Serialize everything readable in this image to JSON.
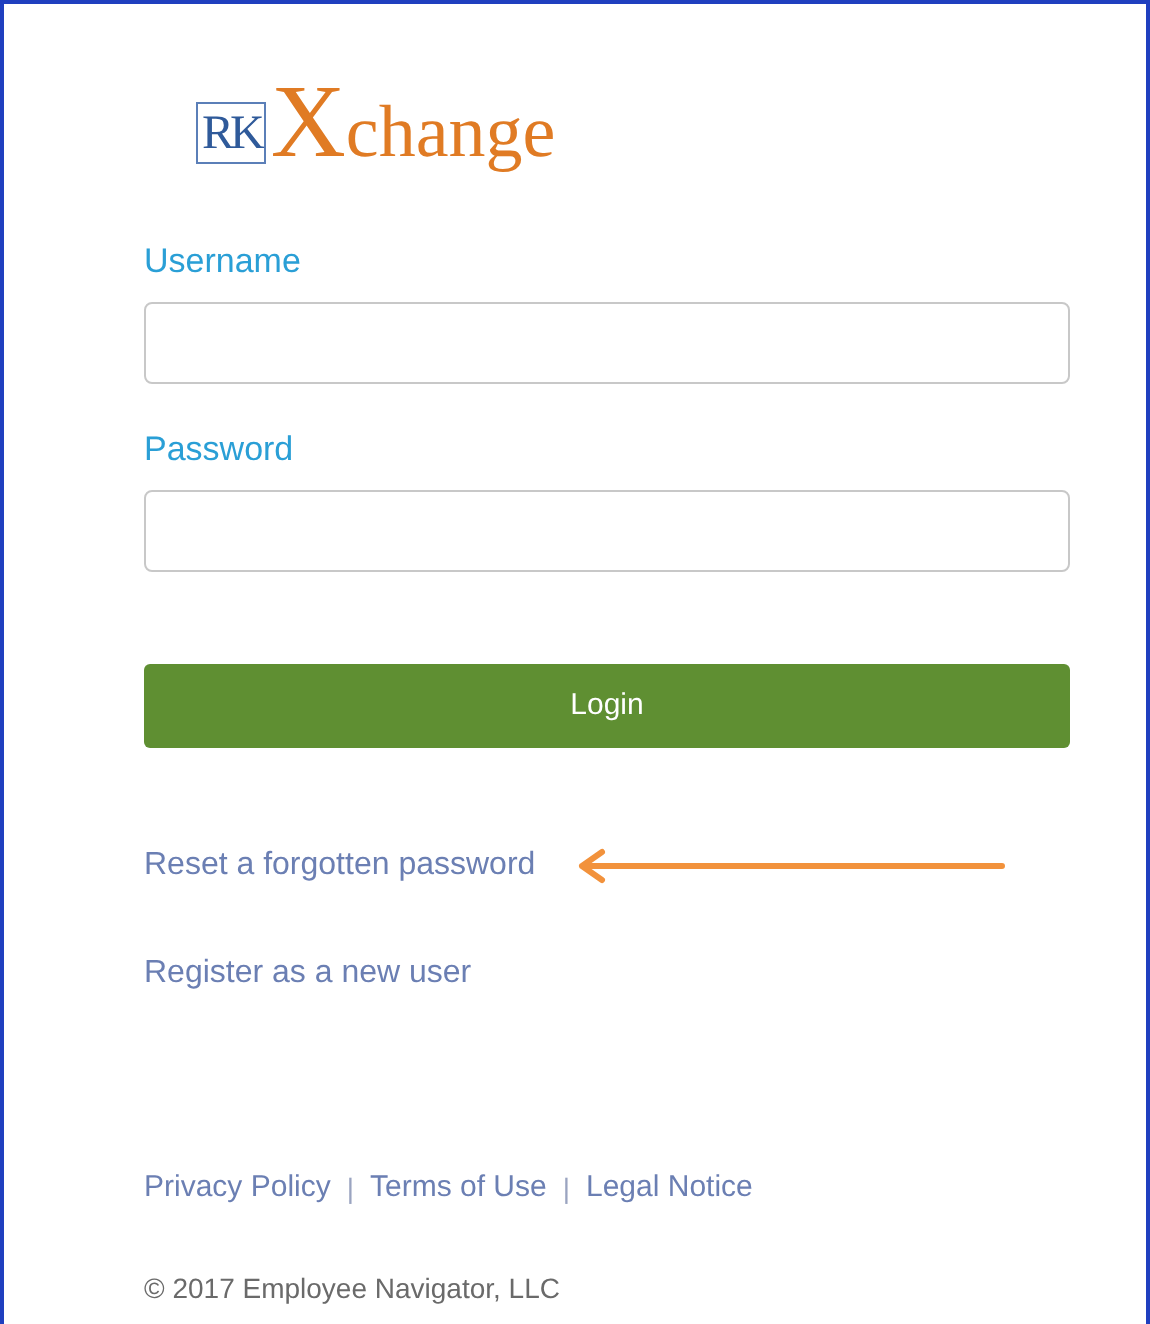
{
  "logo": {
    "mark": "RK",
    "wordmark_initial": "X",
    "wordmark_rest": "change"
  },
  "fields": [
    {
      "label": "Username"
    },
    {
      "label": "Password"
    }
  ],
  "login_button": "Login",
  "links": [
    "Reset a forgotten password",
    "Register as a new user"
  ],
  "footer_links": [
    {
      "label": "Privacy Policy",
      "separator": "|"
    },
    {
      "label": "Terms of Use",
      "separator": "|"
    },
    {
      "label": "Legal Notice"
    }
  ],
  "copyright": "© 2017 Employee Navigator, LLC"
}
